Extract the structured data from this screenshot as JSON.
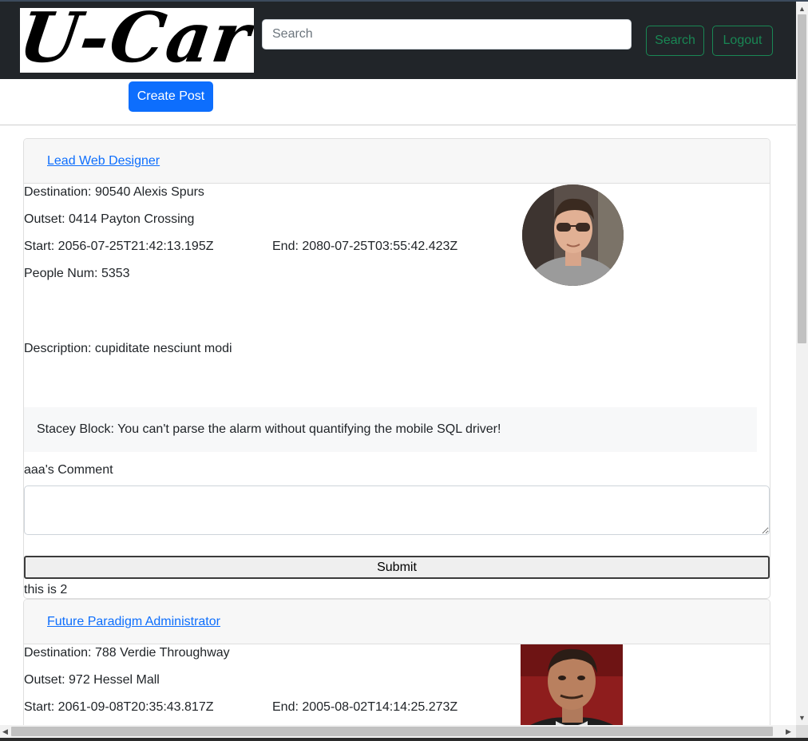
{
  "header": {
    "logo_text": "U-Car",
    "search": {
      "placeholder": "Search",
      "value": ""
    },
    "search_button": "Search",
    "logout_button": "Logout"
  },
  "toolbar": {
    "create_post": "Create Post"
  },
  "posts": [
    {
      "title": "Lead Web Designer",
      "destination": "Destination: 90540 Alexis Spurs",
      "outset": "Outset: 0414 Payton Crossing",
      "start": "Start: 2056-07-25T21:42:13.195Z",
      "end": "End: 2080-07-25T03:55:42.423Z",
      "people": "People Num: 5353",
      "description": "Description: cupiditate nesciunt modi",
      "comment": "Stacey Block: You can't parse the alarm without quantifying the mobile SQL driver!",
      "comment_label": "aaa's Comment",
      "comment_value": "",
      "submit": "Submit",
      "footnote": "this is 2"
    },
    {
      "title": "Future Paradigm Administrator",
      "destination": "Destination: 788 Verdie Throughway",
      "outset": "Outset: 972 Hessel Mall",
      "start": "Start: 2061-09-08T20:35:43.817Z",
      "end": "End: 2005-08-02T14:14:25.273Z"
    }
  ],
  "colors": {
    "navbar_bg": "#212529",
    "success": "#198754",
    "primary": "#0d6efd",
    "card_header": "#f7f7f7"
  },
  "icons": {
    "scroll_up": "scroll-up-arrow-icon",
    "scroll_down": "scroll-down-arrow-icon",
    "scroll_left": "scroll-left-arrow-icon",
    "scroll_right": "scroll-right-arrow-icon"
  }
}
